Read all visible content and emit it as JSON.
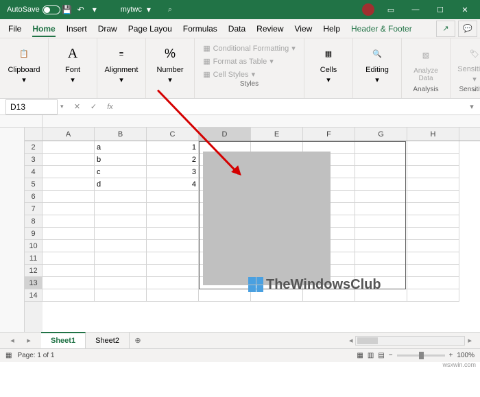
{
  "titlebar": {
    "autosave_label": "AutoSave",
    "autosave_state": "Off",
    "filename": "mytwc",
    "search_ph": "⌕"
  },
  "menu": {
    "file": "File",
    "home": "Home",
    "insert": "Insert",
    "draw": "Draw",
    "pagelayout": "Page Layou",
    "formulas": "Formulas",
    "data": "Data",
    "review": "Review",
    "view": "View",
    "help": "Help",
    "headerfooter": "Header & Footer"
  },
  "ribbon": {
    "clipboard": "Clipboard",
    "font": "Font",
    "alignment": "Alignment",
    "number": "Number",
    "cond_fmt": "Conditional Formatting",
    "fmt_table": "Format as Table",
    "cell_styles": "Cell Styles",
    "styles": "Styles",
    "cells": "Cells",
    "editing": "Editing",
    "analyze": "Analyze Data",
    "analysis": "Analysis",
    "sensitivity": "Sensitivity",
    "sensitivity_grp": "Sensitivity"
  },
  "namebox": "D13",
  "fx": "fx",
  "cols": [
    "A",
    "B",
    "C",
    "D",
    "E",
    "F",
    "G",
    "H"
  ],
  "rows": [
    "2",
    "3",
    "4",
    "5",
    "6",
    "7",
    "8",
    "9",
    "10",
    "11",
    "12",
    "13",
    "14"
  ],
  "cells": {
    "B2": "a",
    "C2": "1",
    "B3": "b",
    "C3": "2",
    "B4": "c",
    "C4": "3",
    "B5": "d",
    "C5": "4"
  },
  "tabs": {
    "s1": "Sheet1",
    "s2": "Sheet2"
  },
  "status": {
    "page": "Page: 1 of 1",
    "zoom": "100%"
  },
  "watermark": "TheWindowsClub",
  "src": "wsxwin.com"
}
